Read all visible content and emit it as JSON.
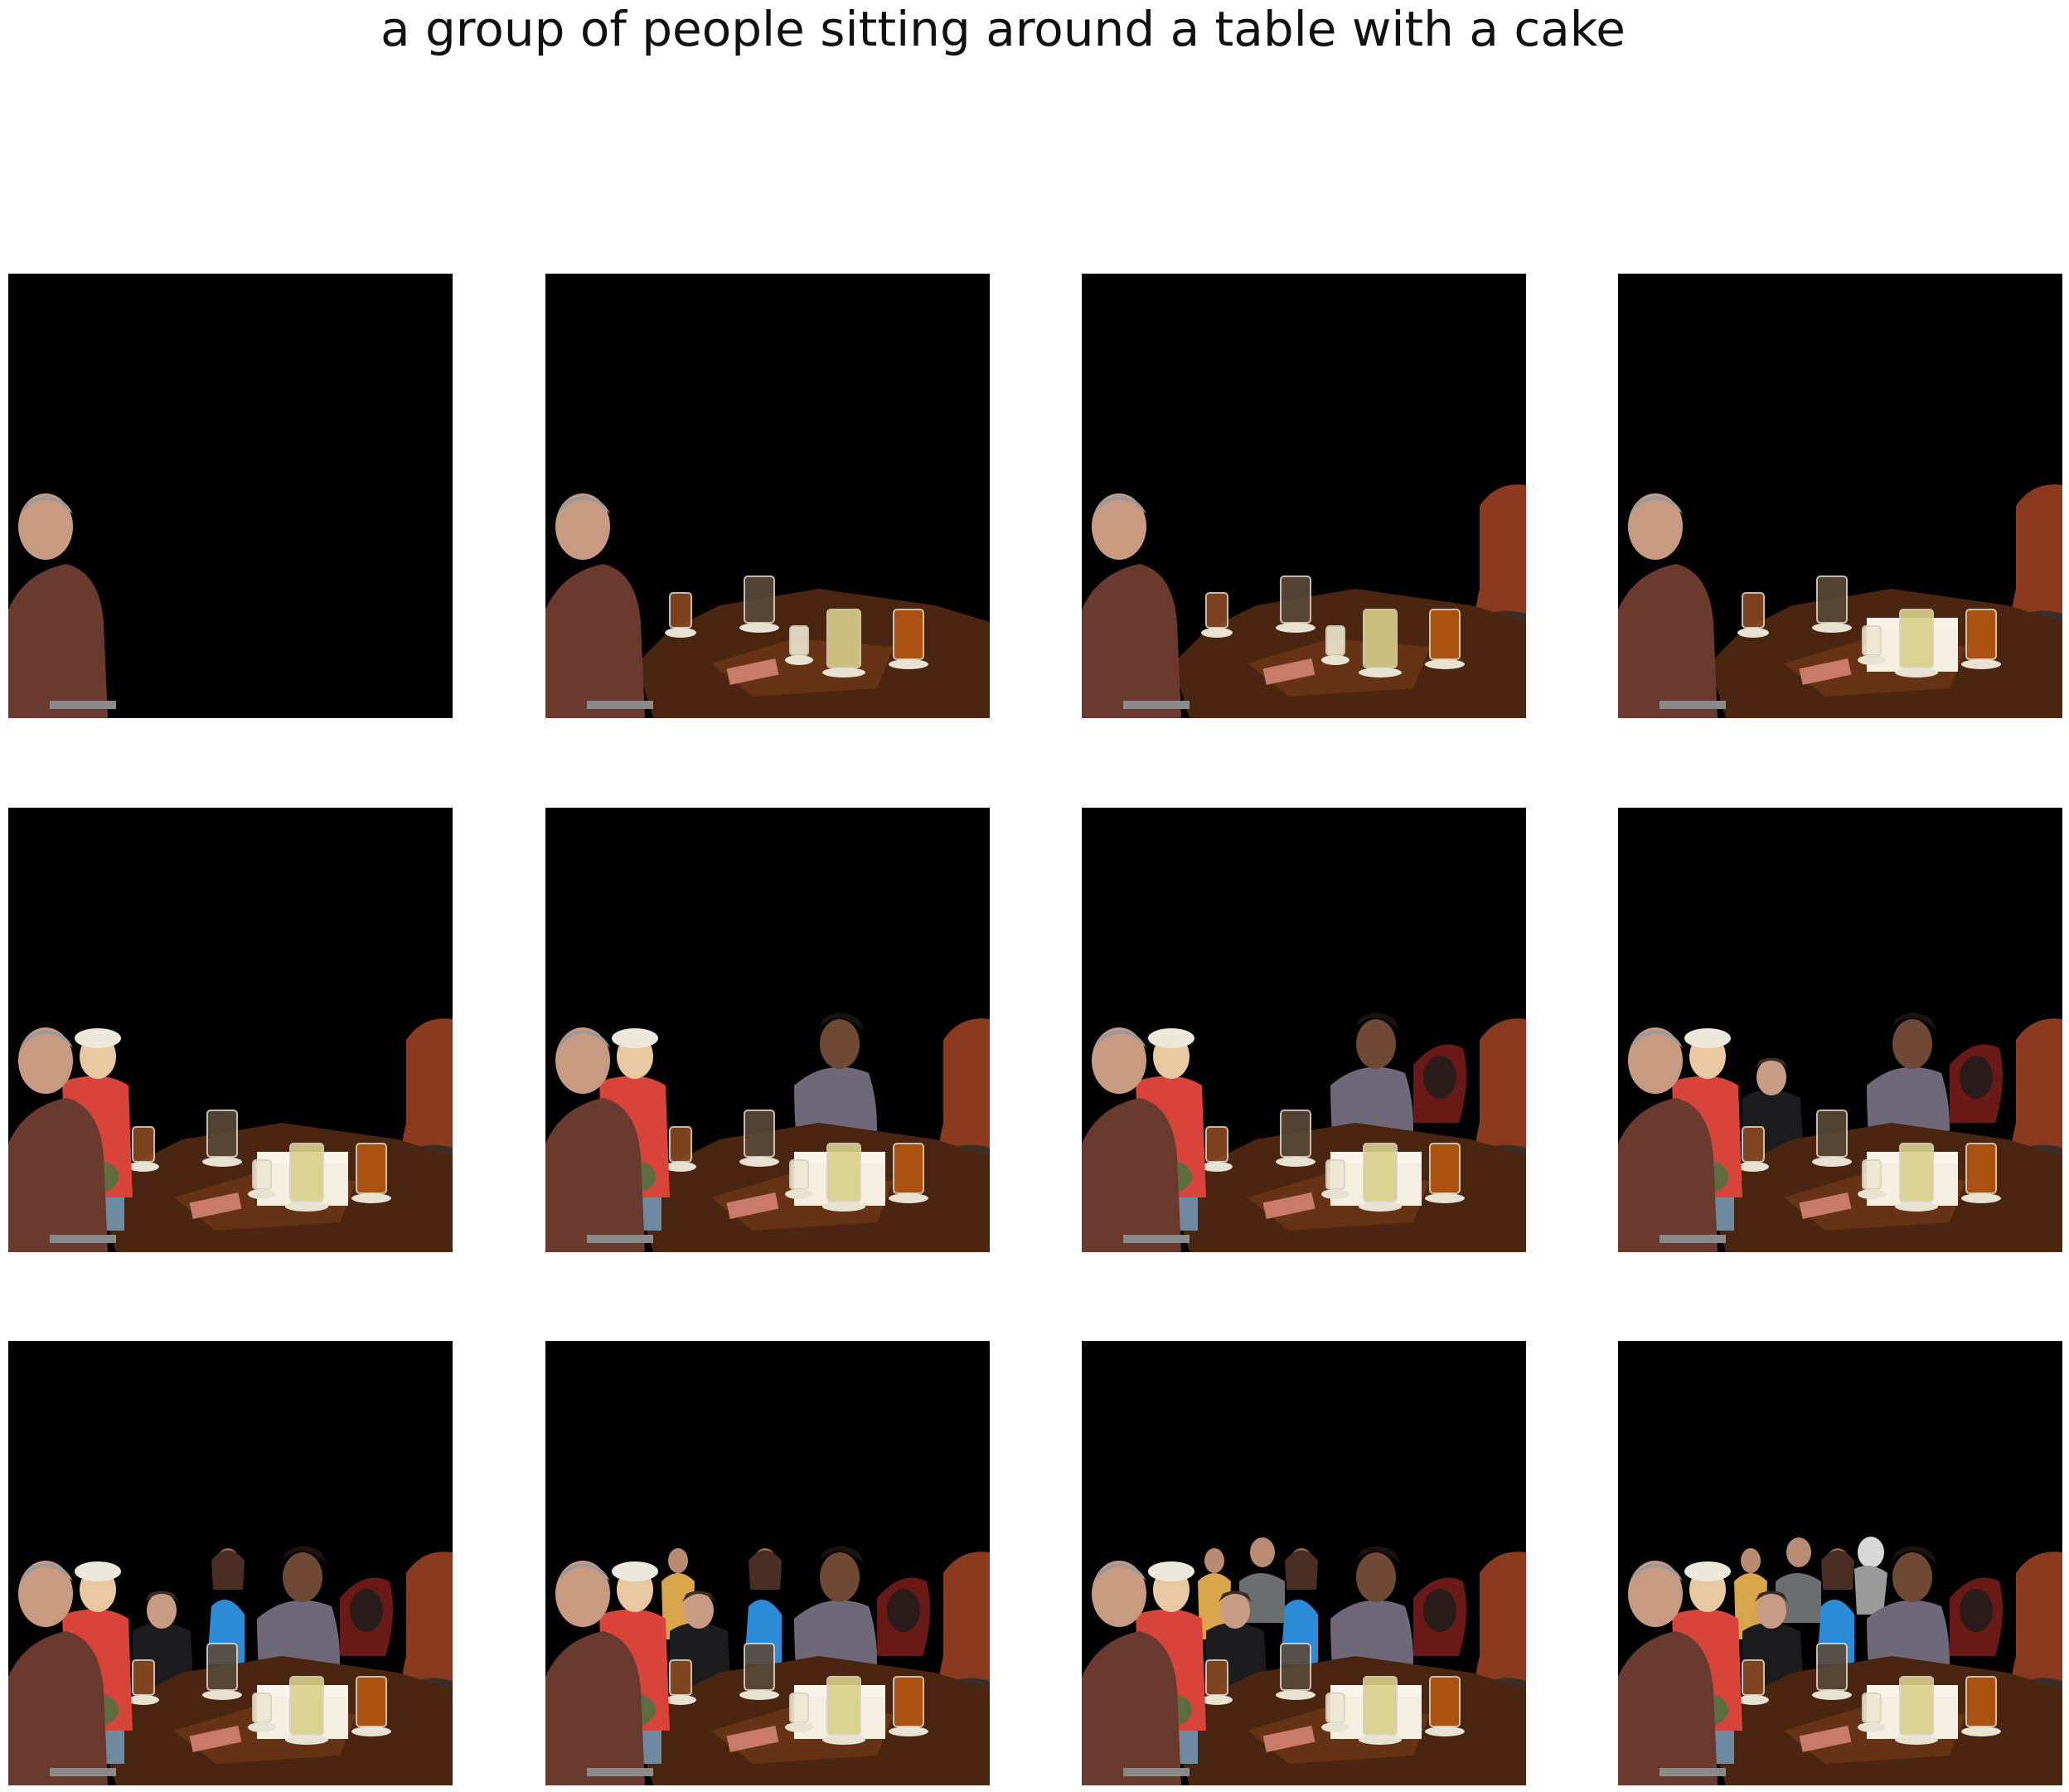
{
  "title": "a group of people sitting around a table with a cake",
  "panels": [
    {
      "id": 1,
      "layers": [
        "man-left"
      ]
    },
    {
      "id": 2,
      "layers": [
        "man-left",
        "table",
        "glasses"
      ]
    },
    {
      "id": 3,
      "layers": [
        "man-left",
        "table",
        "glasses",
        "woman-red-hair"
      ]
    },
    {
      "id": 4,
      "layers": [
        "man-left",
        "table",
        "glasses",
        "woman-red-hair",
        "cake"
      ]
    },
    {
      "id": 5,
      "layers": [
        "man-left",
        "table",
        "glasses",
        "woman-red-hair",
        "cake",
        "woman-white-cap"
      ]
    },
    {
      "id": 6,
      "layers": [
        "man-left",
        "table",
        "glasses",
        "woman-red-hair",
        "cake",
        "woman-white-cap",
        "woman-floral-shirt"
      ]
    },
    {
      "id": 7,
      "layers": [
        "man-left",
        "table",
        "glasses",
        "woman-red-hair",
        "cake",
        "woman-white-cap",
        "woman-floral-shirt",
        "woman-hooded"
      ]
    },
    {
      "id": 8,
      "layers": [
        "man-left",
        "table",
        "glasses",
        "woman-red-hair",
        "cake",
        "woman-white-cap",
        "woman-floral-shirt",
        "woman-hooded",
        "woman-dark-jacket"
      ]
    },
    {
      "id": 9,
      "layers": [
        "man-left",
        "table",
        "glasses",
        "woman-red-hair",
        "cake",
        "woman-white-cap",
        "woman-floral-shirt",
        "woman-hooded",
        "woman-dark-jacket",
        "girl-blue-dress"
      ]
    },
    {
      "id": 10,
      "layers": [
        "man-left",
        "table",
        "glasses",
        "woman-red-hair",
        "cake",
        "woman-white-cap",
        "woman-floral-shirt",
        "woman-hooded",
        "woman-dark-jacket",
        "girl-blue-dress",
        "child-yellow"
      ]
    },
    {
      "id": 11,
      "layers": [
        "man-left",
        "table",
        "glasses",
        "woman-red-hair",
        "cake",
        "woman-white-cap",
        "woman-floral-shirt",
        "woman-hooded",
        "woman-dark-jacket",
        "girl-blue-dress",
        "child-yellow",
        "man-background"
      ]
    },
    {
      "id": 12,
      "layers": [
        "man-left",
        "table",
        "glasses",
        "woman-red-hair",
        "cake",
        "woman-white-cap",
        "woman-floral-shirt",
        "woman-hooded",
        "woman-dark-jacket",
        "girl-blue-dress",
        "child-yellow",
        "man-background",
        "baby-grayscale"
      ]
    }
  ],
  "colors": {
    "background": "#000000",
    "table": "#4a2510",
    "table_highlight": "#7a3e18",
    "skin": "#c89a82",
    "man_shirt": "#6b3a2e",
    "red_hair": "#8a3a1e",
    "beer": "#b5560f",
    "lemonade": "#d8cf8a",
    "cake": "#f4efe0",
    "floral": "#6e6878",
    "white_cap": "#ece8dc",
    "red_top": "#d8443a",
    "blue_dress": "#2b8bd6"
  }
}
